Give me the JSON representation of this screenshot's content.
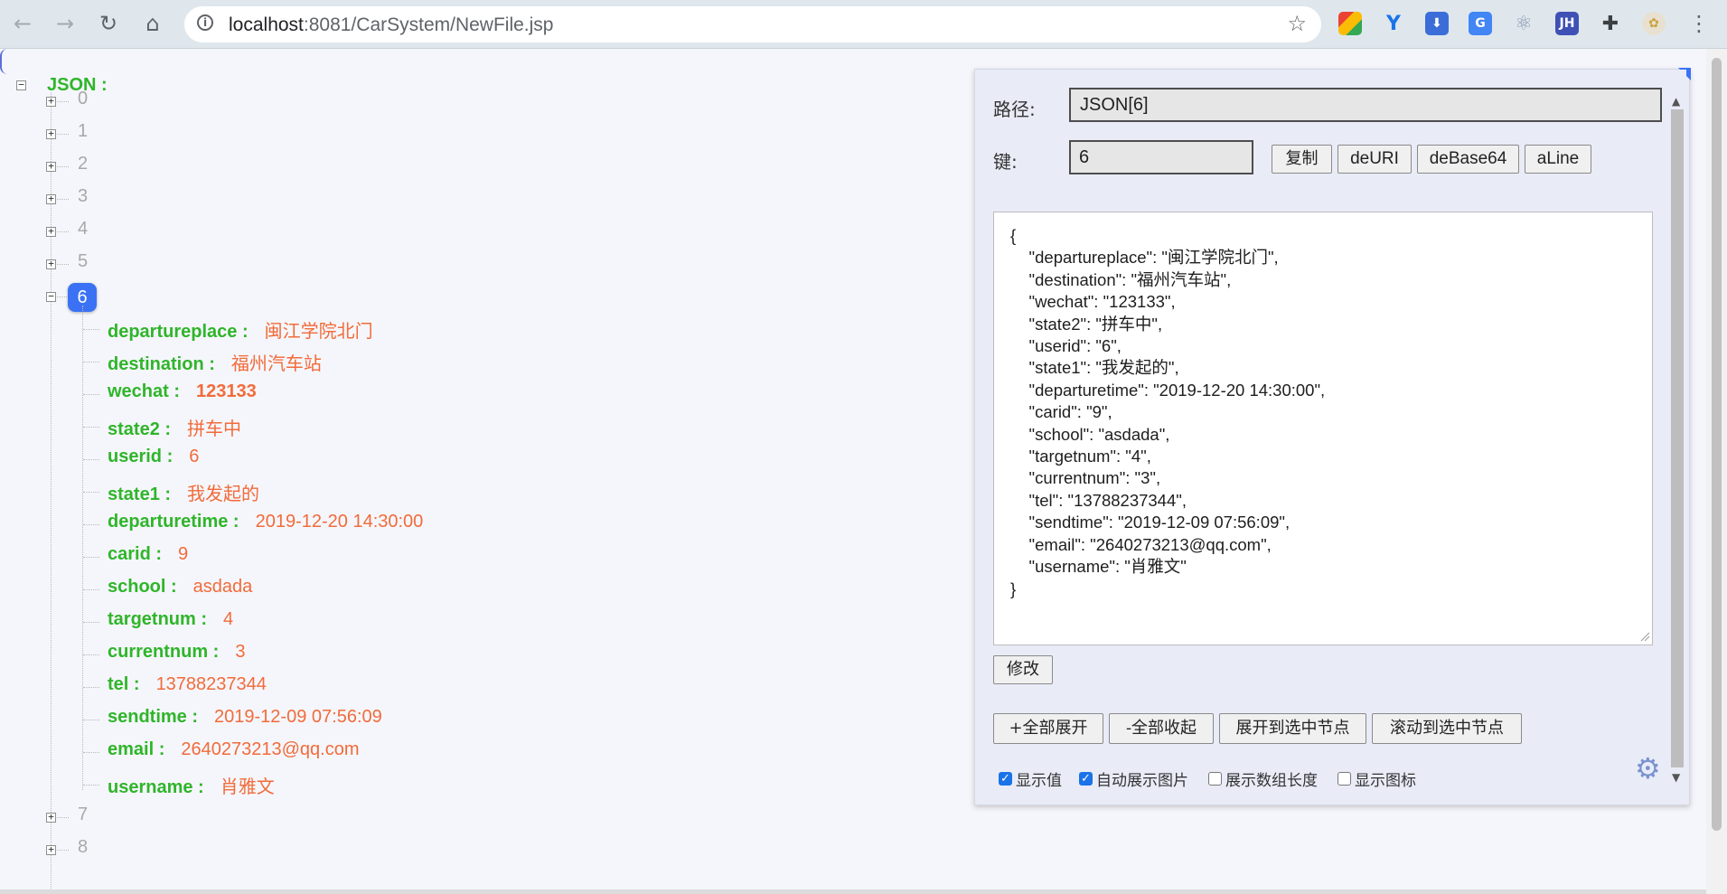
{
  "browser": {
    "url_host": "localhost",
    "url_rest": ":8081/CarSystem/NewFile.jsp",
    "extensions": [
      "color-picker-icon",
      "y-icon",
      "download-icon",
      "translate-icon",
      "react-icon",
      "jh-icon",
      "puzzle-icon",
      "avatar-icon"
    ],
    "ext_jh_label": "JH"
  },
  "tree": {
    "root_label": "JSON :",
    "collapsed_before": [
      "0",
      "1",
      "2",
      "3",
      "4",
      "5"
    ],
    "selected_index": "6",
    "fields": [
      {
        "key": "departureplace :",
        "value": "闽江学院北门"
      },
      {
        "key": "destination :",
        "value": "福州汽车站"
      },
      {
        "key": "wechat :",
        "value": "123133"
      },
      {
        "key": "state2 :",
        "value": "拼车中"
      },
      {
        "key": "userid :",
        "value": "6"
      },
      {
        "key": "state1 :",
        "value": "我发起的"
      },
      {
        "key": "departuretime :",
        "value": "2019-12-20 14:30:00"
      },
      {
        "key": "carid :",
        "value": "9"
      },
      {
        "key": "school :",
        "value": "asdada"
      },
      {
        "key": "targetnum :",
        "value": "4"
      },
      {
        "key": "currentnum :",
        "value": "3"
      },
      {
        "key": "tel :",
        "value": "13788237344"
      },
      {
        "key": "sendtime :",
        "value": "2019-12-09 07:56:09"
      },
      {
        "key": "email :",
        "value": "2640273213@qq.com"
      },
      {
        "key": "username :",
        "value": "肖雅文"
      }
    ],
    "collapsed_after": [
      "7",
      "8"
    ]
  },
  "panel": {
    "path_label": "路径:",
    "path_value": "JSON[6]",
    "key_label": "键:",
    "key_value": "6",
    "btn_copy": "复制",
    "btn_deuri": "deURI",
    "btn_debase64": "deBase64",
    "btn_aline": "aLine",
    "json_text": "{\n    \"departureplace\": \"闽江学院北门\",\n    \"destination\": \"福州汽车站\",\n    \"wechat\": \"123133\",\n    \"state2\": \"拼车中\",\n    \"userid\": \"6\",\n    \"state1\": \"我发起的\",\n    \"departuretime\": \"2019-12-20 14:30:00\",\n    \"carid\": \"9\",\n    \"school\": \"asdada\",\n    \"targetnum\": \"4\",\n    \"currentnum\": \"3\",\n    \"tel\": \"13788237344\",\n    \"sendtime\": \"2019-12-09 07:56:09\",\n    \"email\": \"2640273213@qq.com\",\n    \"username\": \"肖雅文\"\n}",
    "btn_modify": "修改",
    "btn_expand_all": "+全部展开",
    "btn_collapse_all": "-全部收起",
    "btn_expand_to_selected": "展开到选中节点",
    "btn_scroll_to_selected": "滚动到选中节点",
    "checkboxes": [
      {
        "label": "显示值",
        "checked": true
      },
      {
        "label": "自动展示图片",
        "checked": true
      },
      {
        "label": "展示数组长度",
        "checked": false
      },
      {
        "label": "显示图标",
        "checked": false
      }
    ]
  },
  "colors": {
    "key": "#2fb52a",
    "value": "#f26b3a",
    "selected": "#3b72f5",
    "index": "#a8a8a8"
  }
}
